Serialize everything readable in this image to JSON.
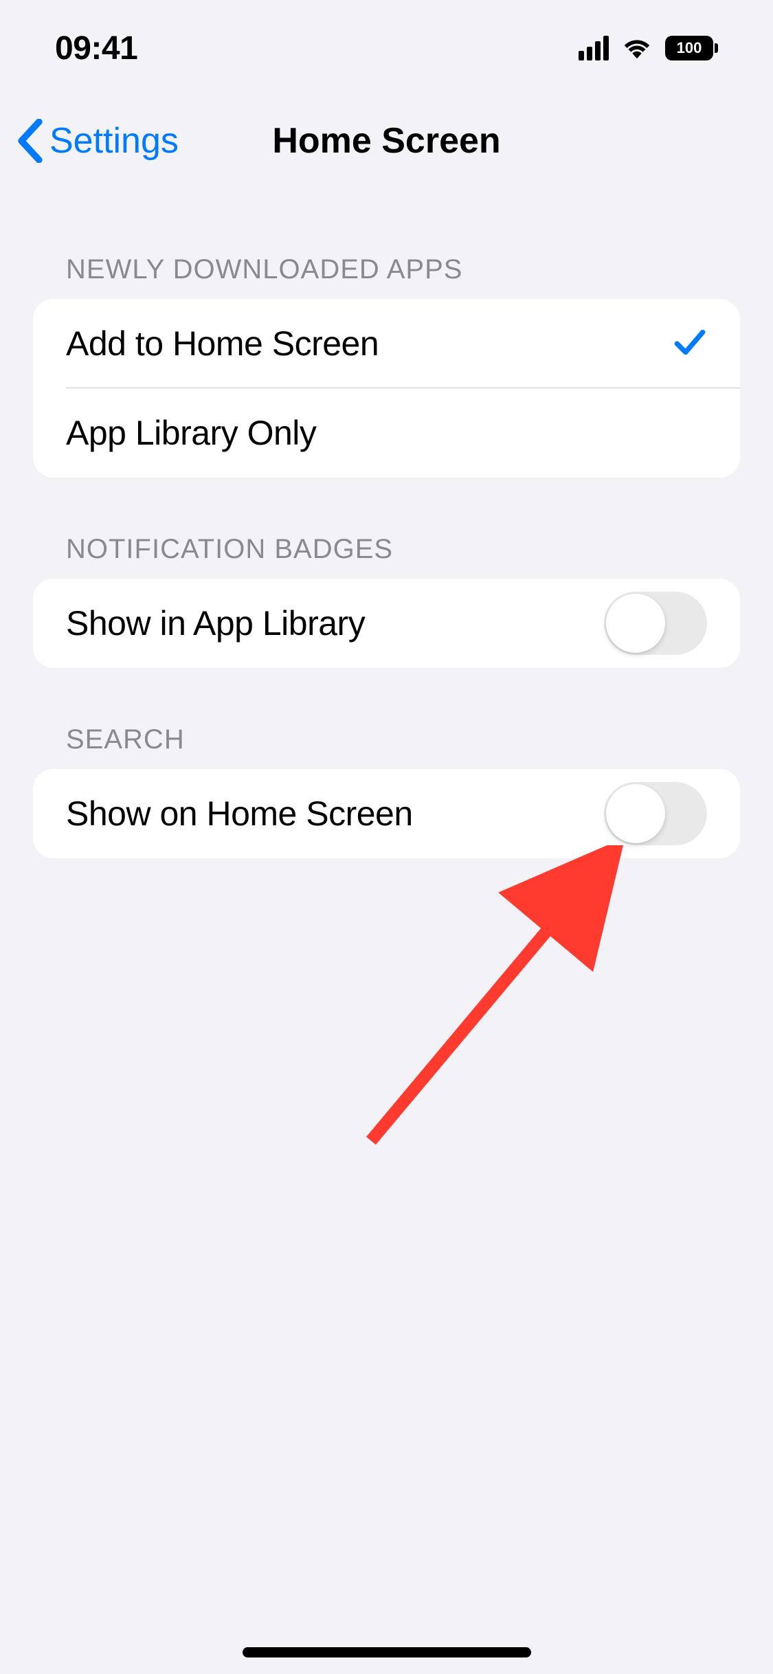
{
  "statusBar": {
    "time": "09:41",
    "batteryLevel": "100"
  },
  "nav": {
    "backLabel": "Settings",
    "title": "Home Screen"
  },
  "sections": {
    "downloadedApps": {
      "header": "NEWLY DOWNLOADED APPS",
      "options": [
        {
          "label": "Add to Home Screen",
          "selected": true
        },
        {
          "label": "App Library Only",
          "selected": false
        }
      ]
    },
    "notificationBadges": {
      "header": "NOTIFICATION BADGES",
      "rows": [
        {
          "label": "Show in App Library",
          "toggle": false
        }
      ]
    },
    "search": {
      "header": "SEARCH",
      "rows": [
        {
          "label": "Show on Home Screen",
          "toggle": false
        }
      ]
    }
  }
}
